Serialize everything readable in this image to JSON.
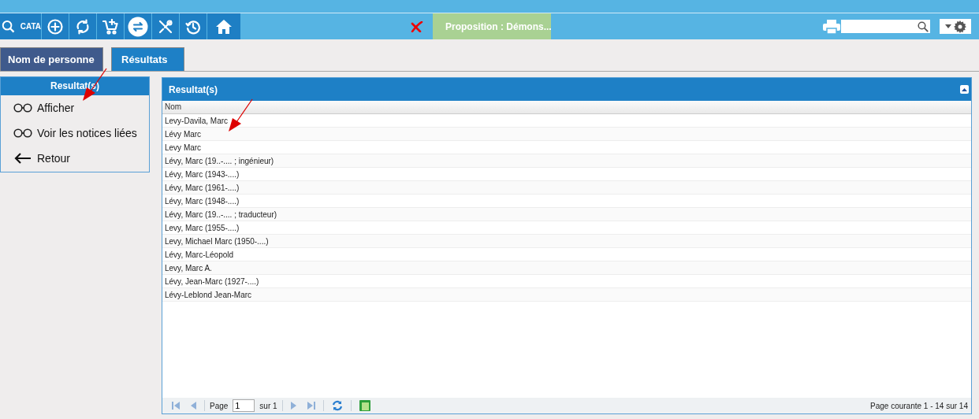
{
  "toolbar": {
    "catalog_label": "CATA",
    "basket_label": "Proposition : Démons..."
  },
  "tabs": [
    {
      "label": "Nom de personne",
      "selected": false
    },
    {
      "label": "Résultats",
      "selected": true
    }
  ],
  "actions_panel": {
    "title": "Resultat(s)",
    "items": [
      {
        "kind": "view",
        "label": "Afficher"
      },
      {
        "kind": "view",
        "label": "Voir les notices liées"
      },
      {
        "kind": "back",
        "label": "Retour"
      }
    ]
  },
  "results_grid": {
    "title": "Resultat(s)",
    "columns": [
      "Nom"
    ],
    "rows": [
      [
        "Levy-Davila, Marc"
      ],
      [
        "Lévy Marc"
      ],
      [
        "Levy Marc"
      ],
      [
        "Lévy, Marc (19..-.... ; ingénieur)"
      ],
      [
        "Lévy, Marc (1943-....)"
      ],
      [
        "Lévy, Marc (1961-....)"
      ],
      [
        "Lévy, Marc (1948-....)"
      ],
      [
        "Lévy, Marc (19..-.... ; traducteur)"
      ],
      [
        "Levy, Marc (1955-....)"
      ],
      [
        "Levy, Michael Marc (1950-....)"
      ],
      [
        "Lévy, Marc-Léopold"
      ],
      [
        "Levy, Marc A."
      ],
      [
        "Lévy, Jean-Marc (1927-....)"
      ],
      [
        "Lévy-Leblond Jean-Marc"
      ]
    ]
  },
  "pager": {
    "page_label": "Page",
    "page_value": "1",
    "total_label": "sur 1",
    "status": "Page courante 1 - 14 sur 14"
  }
}
